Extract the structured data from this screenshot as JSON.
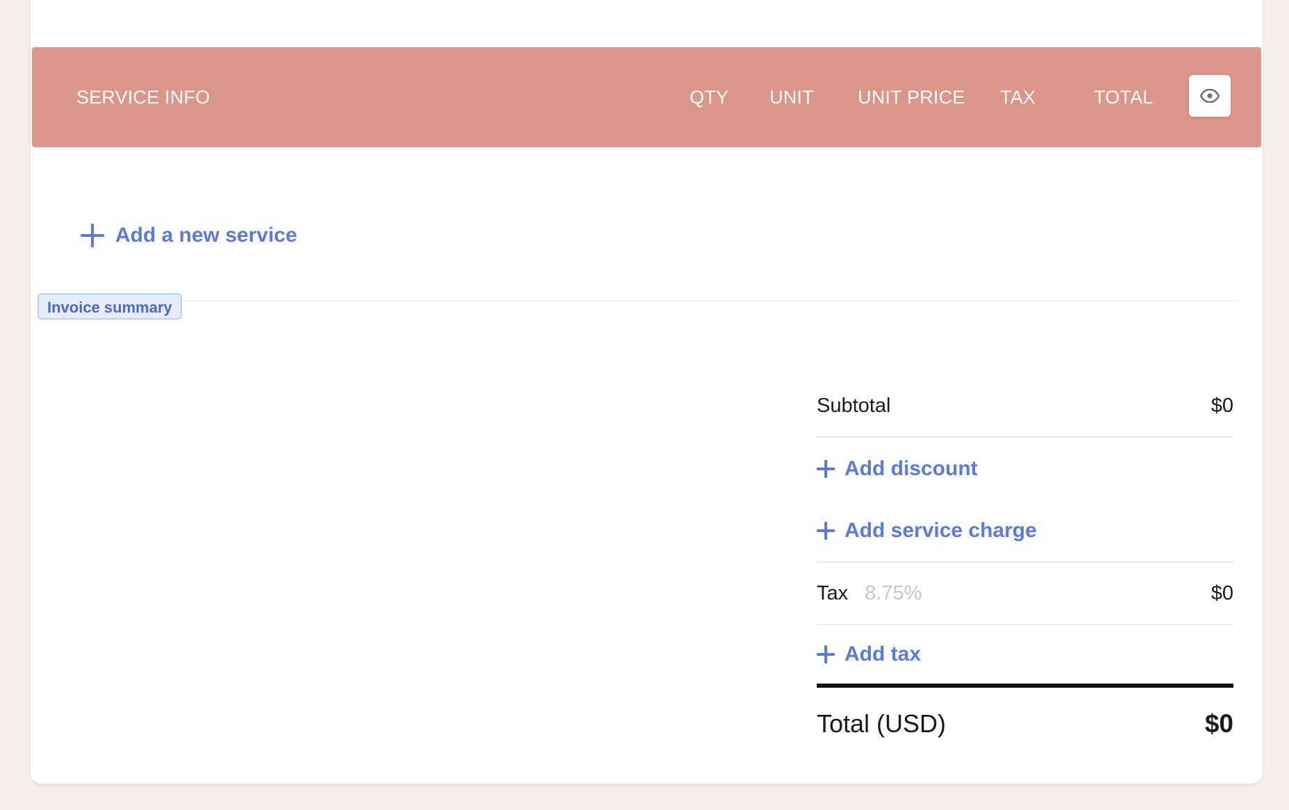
{
  "table_header": {
    "service_info": "SERVICE INFO",
    "qty": "QTY",
    "unit": "UNIT",
    "unit_price": "UNIT PRICE",
    "tax": "TAX",
    "total": "TOTAL",
    "toggle_icon": "eye-icon",
    "background_color": "#dc958b"
  },
  "services": {
    "add_label": "Add a new service"
  },
  "section_badge": "Invoice summary",
  "summary": {
    "subtotal_label": "Subtotal",
    "subtotal_value": "$0",
    "add_discount_label": "Add discount",
    "add_service_charge_label": "Add service charge",
    "tax_label": "Tax",
    "tax_rate": "8.75%",
    "tax_value": "$0",
    "add_tax_label": "Add tax",
    "total_label": "Total (USD)",
    "total_value": "$0"
  },
  "colors": {
    "accent": "#5a7bdc",
    "page_background": "#f6eeeb"
  }
}
